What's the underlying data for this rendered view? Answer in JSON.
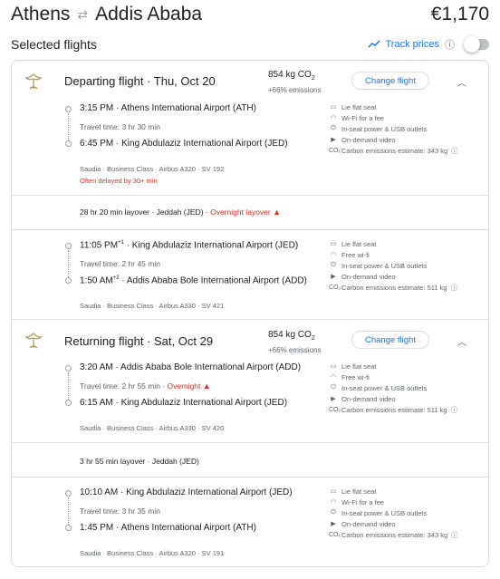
{
  "header": {
    "origin": "Athens",
    "destination": "Addis Ababa",
    "price": "€1,170"
  },
  "selected_title": "Selected flights",
  "track_prices": "Track prices",
  "departing": {
    "title": "Departing flight",
    "date": "Thu, Oct 20",
    "co2": "854 kg CO",
    "co2_sub": "2",
    "emissions": "+66% emissions",
    "change": "Change flight",
    "seg1": {
      "dep_time": "3:15 PM",
      "dep_airport": "Athens International Airport (ATH)",
      "travel": "Travel time: 3 hr 30 min",
      "arr_time": "6:45 PM",
      "arr_airport": "King Abdulaziz International Airport (JED)",
      "meta": "Saudia · Business Class · Airbus A320 · SV 192",
      "delay": "Often delayed by 30+ min",
      "amenities": [
        "Lie flat seat",
        "Wi-Fi for a fee",
        "In-seat power & USB outlets",
        "On-demand video",
        "Carbon emissions estimate: 343 kg"
      ]
    },
    "layover": "28 hr 20 min layover · Jeddah (JED) · ",
    "layover_warn": "Overnight layover",
    "seg2": {
      "dep_time": "11:05 PM",
      "dep_sup": "+1",
      "dep_airport": "King Abdulaziz International Airport (JED)",
      "travel": "Travel time: 2 hr 45 min",
      "arr_time": "1:50 AM",
      "arr_sup": "+2",
      "arr_airport": "Addis Ababa Bole International Airport (ADD)",
      "meta": "Saudia · Business Class · Airbus A330 · SV 421",
      "amenities": [
        "Lie flat seat",
        "Free wi-fi",
        "In-seat power & USB outlets",
        "On-demand video",
        "Carbon emissions estimate: 511 kg"
      ]
    }
  },
  "returning": {
    "title": "Returning flight",
    "date": "Sat, Oct 29",
    "co2": "854 kg CO",
    "co2_sub": "2",
    "emissions": "+66% emissions",
    "change": "Change flight",
    "seg1": {
      "dep_time": "3:20 AM",
      "dep_airport": "Addis Ababa Bole International Airport (ADD)",
      "travel": "Travel time: 2 hr 55 min · ",
      "travel_warn": "Overnight",
      "arr_time": "6:15 AM",
      "arr_airport": "King Abdulaziz International Airport (JED)",
      "meta": "Saudia · Business Class · Airbus A330 · SV 420",
      "amenities": [
        "Lie flat seat",
        "Free wi-fi",
        "In-seat power & USB outlets",
        "On-demand video",
        "Carbon emissions estimate: 511 kg"
      ]
    },
    "layover": "3 hr 55 min layover · Jeddah (JED)",
    "seg2": {
      "dep_time": "10:10 AM",
      "dep_airport": "King Abdulaziz International Airport (JED)",
      "travel": "Travel time: 3 hr 35 min",
      "arr_time": "1:45 PM",
      "arr_airport": "Athens International Airport (ATH)",
      "meta": "Saudia · Business Class · Airbus A320 · SV 191",
      "amenities": [
        "Lie flat seat",
        "Wi-Fi for a fee",
        "In-seat power & USB outlets",
        "On-demand video",
        "Carbon emissions estimate: 343 kg"
      ]
    }
  },
  "amenity_icons": [
    "seat-icon",
    "wifi-icon",
    "power-outlet-icon",
    "video-icon",
    "co2-icon"
  ]
}
